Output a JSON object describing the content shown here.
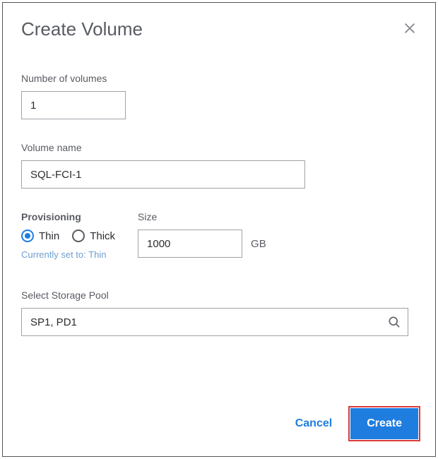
{
  "dialog": {
    "title": "Create Volume"
  },
  "fields": {
    "num_volumes": {
      "label": "Number of volumes",
      "value": "1"
    },
    "volume_name": {
      "label": "Volume name",
      "value": "SQL-FCI-1"
    },
    "provisioning": {
      "label": "Provisioning",
      "options": {
        "thin": "Thin",
        "thick": "Thick"
      },
      "selected": "thin",
      "hint": "Currently set to: Thin"
    },
    "size": {
      "label": "Size",
      "value": "1000",
      "unit": "GB"
    },
    "storage_pool": {
      "label": "Select Storage Pool",
      "value": "SP1, PD1"
    }
  },
  "actions": {
    "cancel": "Cancel",
    "create": "Create"
  },
  "icons": {
    "close": "close-icon",
    "search": "search-icon"
  },
  "colors": {
    "accent": "#1f7de0",
    "text_muted": "#595b63",
    "hint": "#6d9fd0",
    "highlight_outline": "#d93a3a"
  }
}
